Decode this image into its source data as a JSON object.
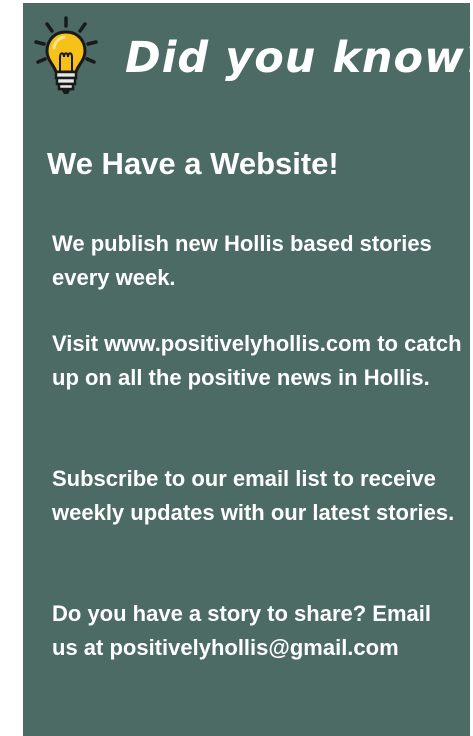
{
  "colors": {
    "card_background": "#4b6b64",
    "text": "#ffffff",
    "bulb_yellow": "#f6c21a"
  },
  "icon": "lightbulb-icon",
  "headline": "Did you know?",
  "title": "We Have a Website!",
  "paragraphs": [
    "We publish new Hollis based stories every week.",
    "Visit www.positivelyhollis.com to catch up on all the positive news in Hollis.",
    "Subscribe to our email list to receive weekly updates with our latest stories.",
    "Do you have a story to share? Email us at positivelyhollis@gmail.com"
  ]
}
